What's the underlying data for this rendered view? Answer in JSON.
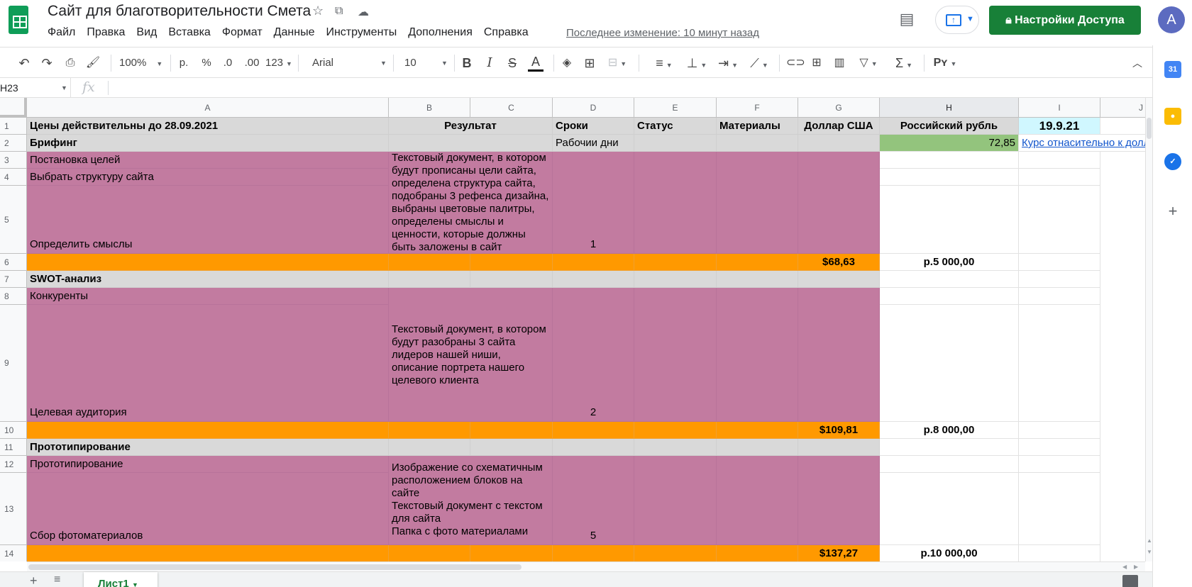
{
  "doc_title": "Сайт для благотворительности Смета",
  "menu": [
    "Файл",
    "Правка",
    "Вид",
    "Вставка",
    "Формат",
    "Данные",
    "Инструменты",
    "Дополнения",
    "Справка"
  ],
  "last_edit": "Последнее изменение: 10 минут назад",
  "share_label": "Настройки Доступа",
  "avatar_letter": "A",
  "toolbar": {
    "zoom": "100%",
    "currency": "р.",
    "percent": "%",
    "dec_less": ".0",
    "dec_more": ".00",
    "format_more": "123",
    "font": "Arial",
    "font_size": "10"
  },
  "namebox": "H23",
  "fx": "fx",
  "columns": [
    "A",
    "B",
    "C",
    "D",
    "E",
    "F",
    "G",
    "H",
    "I",
    "J"
  ],
  "rows": [
    "1",
    "2",
    "3",
    "4",
    "5",
    "6",
    "7",
    "8",
    "9",
    "10",
    "11",
    "12",
    "13",
    "14"
  ],
  "cells": {
    "a1": "Цены действительны до 28.09.2021",
    "b1": "Результат",
    "d1": "Сроки",
    "e1": "Статус",
    "f1": "Материалы",
    "g1": "Доллар США",
    "h1": "Российский рубль",
    "i1": "19.9.21",
    "a2": "Брифинг",
    "d2": "Рабочии дни",
    "h2": "72,85",
    "i2": "Курс отнасительно к доллару",
    "a3": "Постановка целей",
    "a4": "Выбрать структуру сайта",
    "a5": "Определить смыслы",
    "b3": "Текстовый документ,  в котором будут прописаны цели сайта, определена структура сайта, подобраны 3 рефенса дизайна, выбраны цветовые палитры, определены смыслы и ценности, которые должны быть заложены в сайт",
    "d5": "1",
    "g6": "$68,63",
    "h6": "р.5 000,00",
    "a7": "SWOT-анализ",
    "a8": "Конкуренты",
    "a9": "Целевая аудитория",
    "b8": "Текстовый документ, в котором будут разобраны 3 сайта лидеров нашей ниши, описание портрета нашего целевого клиента",
    "d9": "2",
    "g10": "$109,81",
    "h10": "р.8 000,00",
    "a11": "Прототипирование",
    "a12": "Прототипирование",
    "a13": "Сбор фотоматериалов",
    "b12": "Изображение со схематичным расположением блоков на сайте\nТекстовый документ с текстом для сайта\nПапка с фото материалами",
    "d13": "5",
    "g14": "$137,27",
    "h14": "р.10 000,00"
  },
  "sheet_tab": "Лист1",
  "colors": {
    "magenta": "#c27ba0",
    "orange": "#ff9900",
    "gray": "#d9d9d9",
    "green": "#93c47d",
    "cyan": "#d0f7ff",
    "share_green": "#188038"
  }
}
